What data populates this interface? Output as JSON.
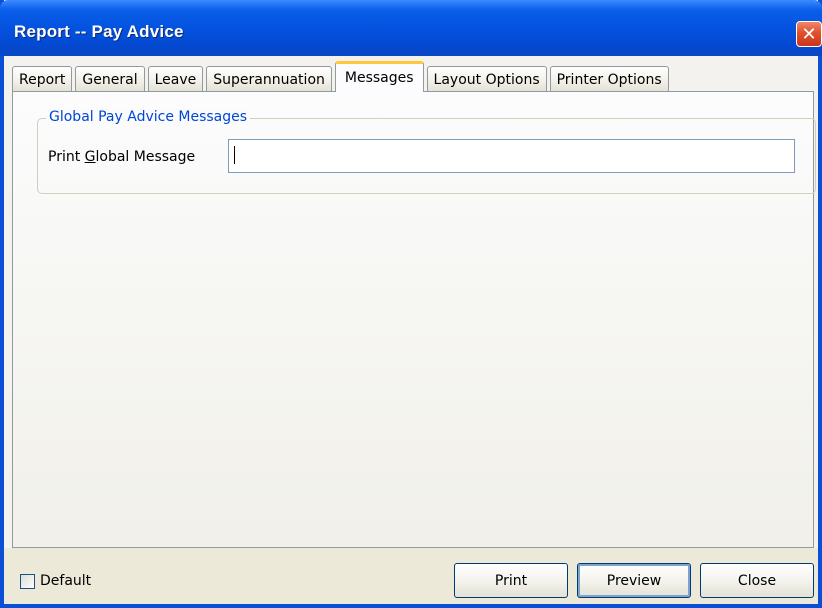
{
  "window": {
    "title": "Report -- Pay Advice",
    "close_glyph": "✕"
  },
  "tabs": [
    {
      "label": "Report",
      "active": false
    },
    {
      "label": "General",
      "active": false
    },
    {
      "label": "Leave",
      "active": false
    },
    {
      "label": "Superannuation",
      "active": false
    },
    {
      "label": "Messages",
      "active": true
    },
    {
      "label": "Layout Options",
      "active": false
    },
    {
      "label": "Printer Options",
      "active": false
    }
  ],
  "messages": {
    "group_title": "Global Pay Advice Messages",
    "field_label_pre": "Print ",
    "field_label_accel": "G",
    "field_label_post": "lobal Message",
    "field_value": ""
  },
  "footer": {
    "default_label": "Default",
    "default_checked": false,
    "print_label": "Print",
    "preview_label": "Preview",
    "close_label": "Close"
  },
  "colors": {
    "titlebar": "#0453e0",
    "group_title": "#0046d5",
    "active_tab_accent": "#ffc83c"
  }
}
